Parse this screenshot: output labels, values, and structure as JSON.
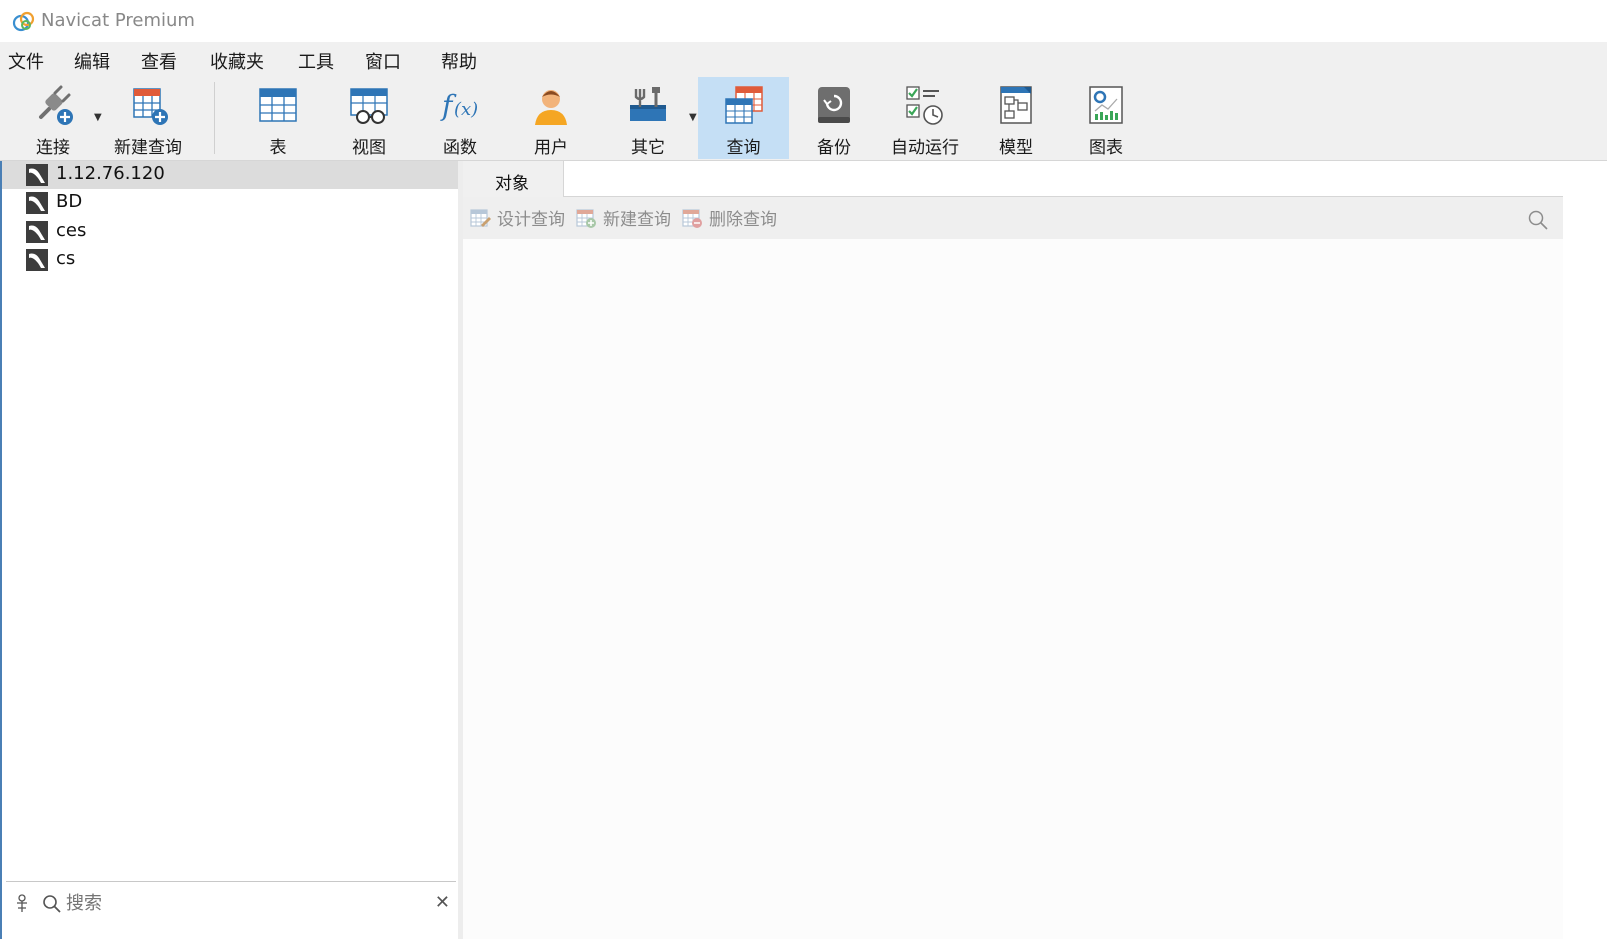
{
  "app": {
    "title": "Navicat Premium"
  },
  "menu": {
    "items": [
      "文件",
      "编辑",
      "查看",
      "收藏夹",
      "工具",
      "窗口",
      "帮助"
    ]
  },
  "toolbar": {
    "connect": "连接",
    "new_query": "新建查询",
    "table": "表",
    "view": "视图",
    "function": "函数",
    "user": "用户",
    "other": "其它",
    "query": "查询",
    "backup": "备份",
    "automation": "自动运行",
    "model": "模型",
    "chart": "图表",
    "active": "查询"
  },
  "connections": [
    "1.12.76.120",
    "BD",
    "ces",
    "cs"
  ],
  "left_search": {
    "placeholder": "搜索"
  },
  "tabs": {
    "objects": "对象"
  },
  "object_toolbar": {
    "design_query": "设计查询",
    "new_query": "新建查询",
    "delete_query": "删除查询"
  },
  "colors": {
    "accent": "#2e75b6",
    "active_tool_bg": "#c5dff5",
    "disabled_text": "#8c8c8c"
  }
}
